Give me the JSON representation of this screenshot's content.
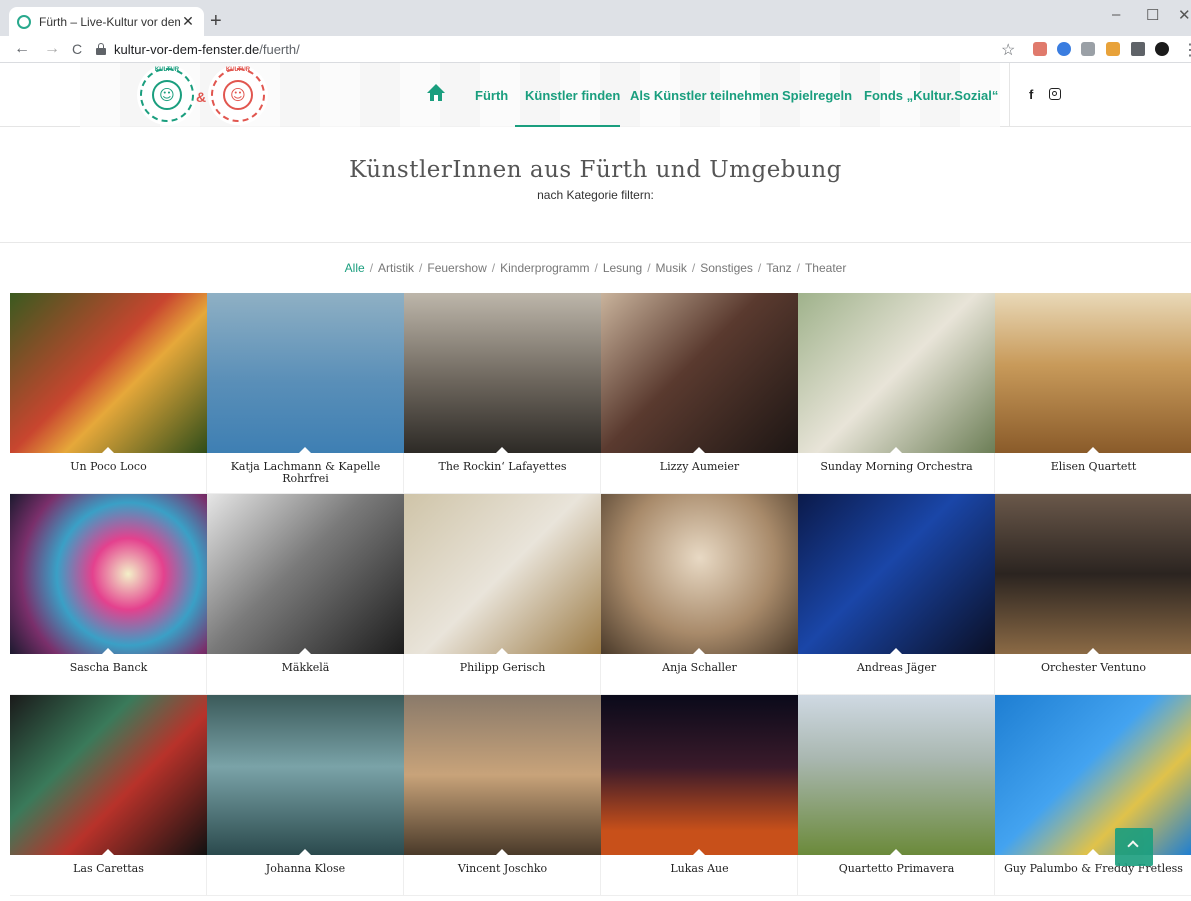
{
  "browser": {
    "tab_title": "Fürth – Live-Kultur vor dem Fens",
    "tab_close": "✕",
    "new_tab": "+",
    "win_min": "–",
    "win_max": "☐",
    "win_close": "✕",
    "url_domain": "kultur-vor-dem-fenster.de",
    "url_path": "/fuerth/",
    "back": "←",
    "forward": "→",
    "reload": "C",
    "star": "☆",
    "menu": "⋮"
  },
  "header": {
    "logo1_text": "KULTUR",
    "logo2_text": "KULTUR",
    "amp": "&",
    "nav": [
      {
        "label": "Fürth"
      },
      {
        "label": "Künstler finden"
      },
      {
        "label": "Als Künstler teilnehmen"
      },
      {
        "label": "Spielregeln"
      },
      {
        "label": "Fonds „Kultur.Sozial“"
      }
    ],
    "facebook": "f"
  },
  "main": {
    "title": "KünstlerInnen aus Fürth und Umgebung",
    "subtitle": "nach Kategorie filtern:",
    "filters": [
      "Alle",
      "Artistik",
      "Feuershow",
      "Kinderprogramm",
      "Lesung",
      "Musik",
      "Sonstiges",
      "Tanz",
      "Theater"
    ],
    "active_filter": "Alle"
  },
  "artists": [
    {
      "name": "Un Poco Loco",
      "bg": "linear-gradient(135deg,#3a5a1f,#c8452f 45%,#e6a83a 60%,#2f4d1a)"
    },
    {
      "name": "Katja Lachmann & Kapelle Rohrfrei",
      "bg": "linear-gradient(180deg,#8fb0c4,#5a8fb8 55%,#3e7fb3)"
    },
    {
      "name": "The Rockin‘ Lafayettes",
      "bg": "linear-gradient(180deg,#bdb6aa,#6d665d 55%,#2d2a26)"
    },
    {
      "name": "Lizzy Aumeier",
      "bg": "linear-gradient(135deg,#c9b39c,#5a3a2f 45%,#1d1614)"
    },
    {
      "name": "Sunday Morning Orchestra",
      "bg": "linear-gradient(135deg,#9fb28b,#e8e4d8 50%,#6c7e56)"
    },
    {
      "name": "Elisen Quartett",
      "bg": "linear-gradient(180deg,#e9d9b8,#c89a5a 45%,#8a5b2a)"
    },
    {
      "name": "Sascha Banck",
      "bg": "radial-gradient(circle at 60% 50%,#f3f0c8,#e4418e 25%,#3aa0c6 50%,#7a2f6b 75%,#1c1a2f)"
    },
    {
      "name": "Mäkkelä",
      "bg": "linear-gradient(135deg,#e6e6e6,#7a7a7a 45%,#1d1d1d)"
    },
    {
      "name": "Philipp Gerisch",
      "bg": "linear-gradient(135deg,#cfc4a8,#e9e4da 50%,#9b7a44)"
    },
    {
      "name": "Anja Schaller",
      "bg": "radial-gradient(circle at 50% 40%,#e8d9c4,#a88a6a 55%,#4a3a2a)"
    },
    {
      "name": "Andreas Jäger",
      "bg": "linear-gradient(135deg,#0b1a4a,#1a46a8 45%,#0a0f25)"
    },
    {
      "name": "Orchester Ventuno",
      "bg": "linear-gradient(180deg,#6a584a,#2b2420 50%,#8b6a45)"
    },
    {
      "name": "Las Carettas",
      "bg": "linear-gradient(135deg,#1a1a1a,#3a7a5a 35%,#b8322a 60%,#111)"
    },
    {
      "name": "Johanna Klose",
      "bg": "linear-gradient(180deg,#3b5a5a,#7aa3a8 45%,#2b4a4d)"
    },
    {
      "name": "Vincent Joschko",
      "bg": "linear-gradient(180deg,#8a7a6a,#c8a37a 50%,#4a3a2a)"
    },
    {
      "name": "Lukas Aue",
      "bg": "linear-gradient(180deg,#0a0a1a,#3a1a2a 45%,#c8501a 85%)"
    },
    {
      "name": "Quartetto Primavera",
      "bg": "linear-gradient(180deg,#cfd9e3,#a9b7b0 40%,#6b8a3a)"
    },
    {
      "name": "Guy Palumbo & Freddy Fretless",
      "bg": "linear-gradient(135deg,#1e7ed2,#43a3f0 45%,#e0c24a 70%,#1e7ed2)"
    }
  ]
}
